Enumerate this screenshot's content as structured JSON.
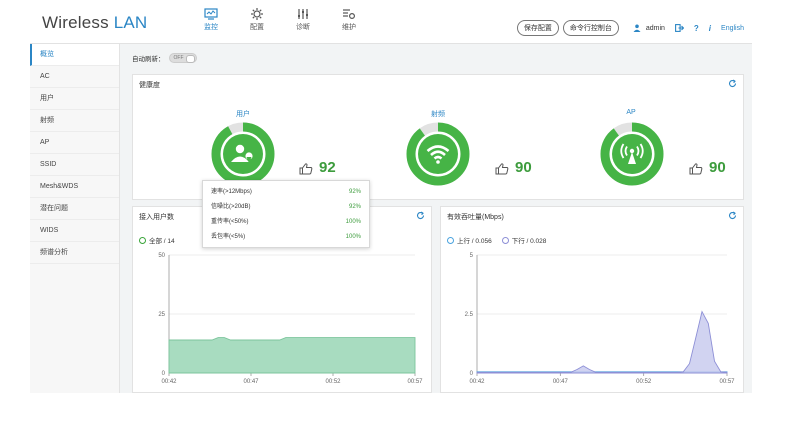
{
  "brand": {
    "prefix": "Wireless ",
    "highlight": "LAN"
  },
  "nav": [
    {
      "label": "监控",
      "icon": "monitor-icon",
      "active": true
    },
    {
      "label": "配置",
      "icon": "gear-icon",
      "active": false
    },
    {
      "label": "诊断",
      "icon": "diagnose-icon",
      "active": false
    },
    {
      "label": "维护",
      "icon": "maintenance-icon",
      "active": false
    }
  ],
  "header_right": {
    "save_config": "保存配置",
    "cli": "命令行控制台",
    "user": "admin",
    "logout_icon": "logout-icon",
    "help": "?",
    "info": "i",
    "language": "English"
  },
  "sidebar": {
    "items": [
      "概览",
      "AC",
      "用户",
      "射频",
      "AP",
      "SSID",
      "Mesh&WDS",
      "潜在问题",
      "WIDS",
      "频谱分析"
    ]
  },
  "auto_refresh": {
    "label": "自动刷新：",
    "state": "OFF"
  },
  "health": {
    "title": "健康度",
    "gauges": [
      {
        "label": "用户",
        "score": "92",
        "icon": "users-icon",
        "value": 92
      },
      {
        "label": "射频",
        "score": "90",
        "icon": "wifi-icon",
        "value": 90
      },
      {
        "label": "AP",
        "score": "90",
        "icon": "ap-antenna-icon",
        "value": 90
      }
    ]
  },
  "tooltip": {
    "rows": [
      {
        "label": "速率(>12Mbps)",
        "value": "92%"
      },
      {
        "label": "信噪比(>20dB)",
        "value": "92%"
      },
      {
        "label": "重传率(<50%)",
        "value": "100%"
      },
      {
        "label": "丢包率(<5%)",
        "value": "100%"
      }
    ]
  },
  "users_panel": {
    "title": "接入用户数",
    "legend": "全部 / 14",
    "legend_color": "#3aa53a"
  },
  "throughput_panel": {
    "title": "有效吞吐量(Mbps)",
    "legend_up": "上行 / 0.056",
    "legend_down": "下行 / 0.028",
    "up_color": "#4aa3df",
    "down_color": "#8d8fd6"
  },
  "colors": {
    "accent": "#2b86c5",
    "good": "#3d9c3d",
    "area_green": "#a8dcc0",
    "area_purple": "#c9cbee"
  },
  "chart_data": [
    {
      "type": "area",
      "title": "接入用户数",
      "ylim": [
        0,
        50
      ],
      "y_ticks": [
        "50",
        "25",
        "0"
      ],
      "x_ticks": [
        "00:42",
        "00:47",
        "00:52",
        "00:57"
      ],
      "series": [
        {
          "name": "全部",
          "values": [
            14,
            14,
            14,
            14,
            14,
            14,
            14,
            14,
            15,
            15,
            14,
            14,
            14,
            14,
            14,
            14,
            14,
            14,
            14,
            15,
            15,
            15,
            15,
            15,
            15,
            15,
            15,
            15,
            15,
            15,
            15,
            15,
            15,
            15,
            15,
            15,
            15,
            15,
            15,
            15,
            15
          ]
        }
      ]
    },
    {
      "type": "area",
      "title": "有效吞吐量(Mbps)",
      "ylim": [
        0,
        5
      ],
      "y_ticks": [
        "5",
        "2.5",
        "0"
      ],
      "x_ticks": [
        "00:42",
        "00:47",
        "00:52",
        "00:57"
      ],
      "series": [
        {
          "name": "上行",
          "values": [
            0.05,
            0.05,
            0.05,
            0.05,
            0.05,
            0.05,
            0.05,
            0.05,
            0.05,
            0.05,
            0.05,
            0.05,
            0.05,
            0.05,
            0.05,
            0.05,
            0.05,
            0.05,
            0.05,
            0.05,
            0.05,
            0.05,
            0.05,
            0.05,
            0.05,
            0.05,
            0.05,
            0.05,
            0.05,
            0.05,
            0.05,
            0.05,
            0.05,
            0.05,
            0.05,
            0.05,
            0.05,
            0.05,
            0.05,
            0.05,
            0.05
          ]
        },
        {
          "name": "下行",
          "values": [
            0.03,
            0.03,
            0.03,
            0.03,
            0.03,
            0.03,
            0.03,
            0.03,
            0.03,
            0.03,
            0.03,
            0.03,
            0.03,
            0.03,
            0.03,
            0.03,
            0.15,
            0.3,
            0.15,
            0.03,
            0.03,
            0.03,
            0.03,
            0.03,
            0.03,
            0.03,
            0.03,
            0.03,
            0.03,
            0.03,
            0.03,
            0.03,
            0.03,
            0.05,
            0.4,
            1.5,
            2.6,
            2.1,
            0.5,
            0.05,
            0.03
          ]
        }
      ]
    }
  ]
}
